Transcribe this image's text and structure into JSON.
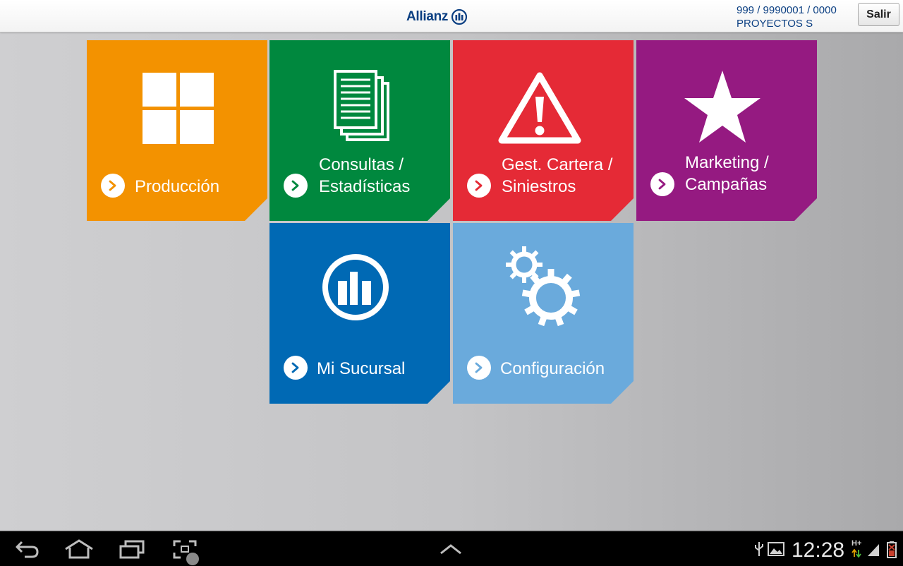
{
  "header": {
    "brand": "Allianz",
    "account_line1": "999 / 9990001 / 0000",
    "account_line2": "PROYECTOS S",
    "logout_label": "Salir"
  },
  "tiles": [
    {
      "id": "produccion",
      "label": "Producción",
      "color": "#f39200",
      "icon": "grid-icon"
    },
    {
      "id": "consultas",
      "label": "Consultas /\nEstadísticas",
      "color": "#00883e",
      "icon": "documents-icon"
    },
    {
      "id": "cartera",
      "label": "Gest. Cartera /\nSiniestros",
      "color": "#e52a36",
      "icon": "warning-icon"
    },
    {
      "id": "marketing",
      "label": "Marketing /\nCampañas",
      "color": "#951a81",
      "icon": "star-icon"
    },
    {
      "id": "sucursal",
      "label": "Mi Sucursal",
      "color": "#0069b4",
      "icon": "allianz-logo-icon"
    },
    {
      "id": "configuracion",
      "label": "Configuración",
      "color": "#6aaadc",
      "icon": "gears-icon"
    }
  ],
  "statusbar": {
    "time": "12:28",
    "network": "H+"
  }
}
